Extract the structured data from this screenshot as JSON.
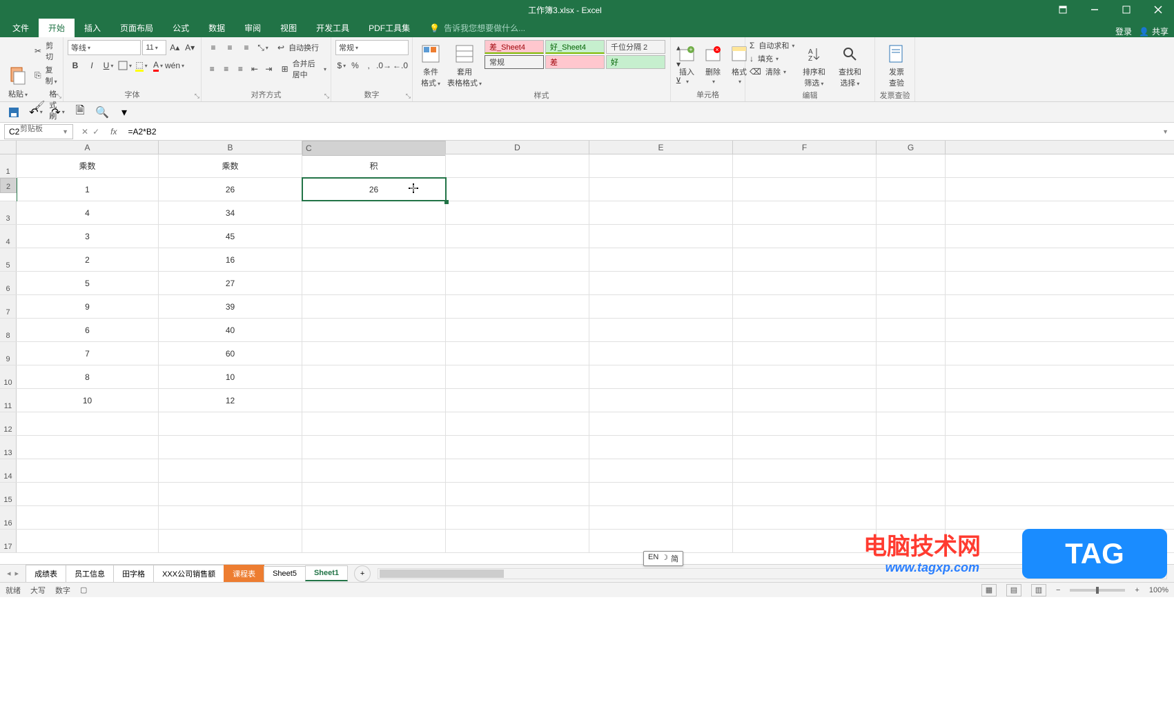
{
  "window": {
    "title": "工作簿3.xlsx - Excel"
  },
  "tabs": {
    "file": "文件",
    "home": "开始",
    "insert": "插入",
    "layout": "页面布局",
    "formulas": "公式",
    "data": "数据",
    "review": "审阅",
    "view": "视图",
    "dev": "开发工具",
    "pdf": "PDF工具集",
    "tellme": "告诉我您想要做什么...",
    "login": "登录",
    "share": "共享"
  },
  "ribbon": {
    "clipboard": {
      "label": "剪贴板",
      "paste": "粘贴",
      "cut": "剪切",
      "copy": "复制",
      "painter": "格式刷"
    },
    "font": {
      "label": "字体",
      "name": "等线",
      "size": "11"
    },
    "align": {
      "label": "对齐方式",
      "wrap": "自动换行",
      "merge": "合并后居中"
    },
    "number": {
      "label": "数字",
      "format": "常规"
    },
    "styles": {
      "label": "样式",
      "cond": "条件格式",
      "table": "套用\n表格格式",
      "s1": "差_Sheet4",
      "s2": "好_Sheet4",
      "s3": "千位分隔 2",
      "s4": "常规",
      "s5": "差",
      "s6": "好"
    },
    "cells": {
      "label": "单元格",
      "insert": "插入",
      "delete": "删除",
      "format": "格式"
    },
    "editing": {
      "label": "编辑",
      "sum": "自动求和",
      "fill": "填充",
      "clear": "清除",
      "sort": "排序和筛选",
      "find": "查找和选择"
    },
    "invoice": {
      "label": "发票查验",
      "btn": "发票\n查验"
    }
  },
  "formula_bar": {
    "cell_ref": "C2",
    "formula": "=A2*B2"
  },
  "grid": {
    "columns": [
      "A",
      "B",
      "C",
      "D",
      "E",
      "F",
      "G"
    ],
    "headers": {
      "A": "乘数",
      "B": "乘数",
      "C": "积"
    },
    "rows": [
      {
        "A": "1",
        "B": "26",
        "C": "26"
      },
      {
        "A": "4",
        "B": "34",
        "C": ""
      },
      {
        "A": "3",
        "B": "45",
        "C": ""
      },
      {
        "A": "2",
        "B": "16",
        "C": ""
      },
      {
        "A": "5",
        "B": "27",
        "C": ""
      },
      {
        "A": "9",
        "B": "39",
        "C": ""
      },
      {
        "A": "6",
        "B": "40",
        "C": ""
      },
      {
        "A": "7",
        "B": "60",
        "C": ""
      },
      {
        "A": "8",
        "B": "10",
        "C": ""
      },
      {
        "A": "10",
        "B": "12",
        "C": ""
      }
    ],
    "selected": "C2"
  },
  "sheet_tabs": {
    "t1": "成绩表",
    "t2": "员工信息",
    "t3": "田字格",
    "t4": "XXX公司销售额",
    "t5": "课程表",
    "t6": "Sheet5",
    "t7": "Sheet1"
  },
  "ime": {
    "lang": "EN",
    "mode": "简"
  },
  "status": {
    "ready": "就绪",
    "caps": "大写",
    "num": "数字",
    "zoom": "100%"
  },
  "watermark": {
    "text": "电脑技术网",
    "url": "www.tagxp.com",
    "tag": "TAG"
  }
}
